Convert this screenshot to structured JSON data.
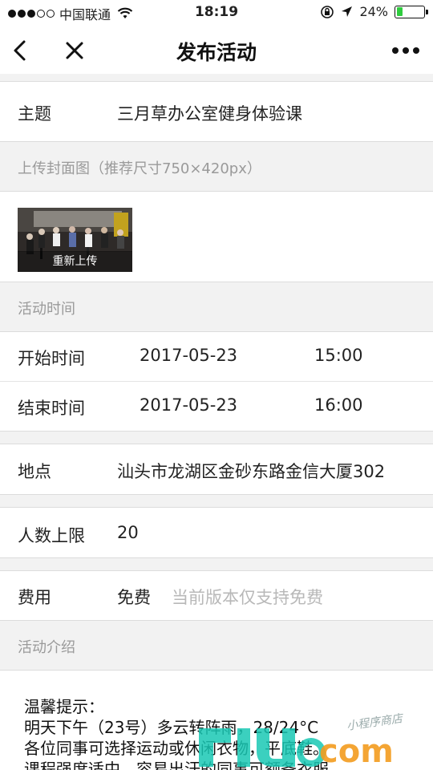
{
  "status_bar": {
    "carrier": "中国联通",
    "time": "18:19",
    "battery": "24%",
    "battery_level": 0.24,
    "signal_bars": 3
  },
  "nav": {
    "title": "发布活动"
  },
  "form": {
    "topic": {
      "label": "主题",
      "value": "三月草办公室健身体验课"
    },
    "cover_section_label": "上传封面图（推荐尺寸750×420px）",
    "reupload_label": "重新上传",
    "time_section_label": "活动时间",
    "start": {
      "label": "开始时间",
      "date": "2017-05-23",
      "time": "15:00"
    },
    "end": {
      "label": "结束时间",
      "date": "2017-05-23",
      "time": "16:00"
    },
    "location": {
      "label": "地点",
      "value": "汕头市龙湖区金砂东路金信大厦302"
    },
    "limit": {
      "label": "人数上限",
      "value": "20"
    },
    "fee": {
      "label": "费用",
      "value": "免费",
      "hint": "当前版本仅支持免费"
    },
    "intro_section_label": "活动介绍",
    "intro_lines": [
      "温馨提示：",
      "明天下午（23号）多云转阵雨，28/24°C",
      "各位同事可选择运动或休闲衣物，平底鞋。",
      "课程强度适中，容易出汗的同事可额备衣服"
    ]
  },
  "watermark": {
    "text": "com",
    "small_text": "小程序商店"
  },
  "colors": {
    "battery_green": "#2fcc3e",
    "watermark_teal": "#19c8b4",
    "watermark_orange": "#f39c1f",
    "hint_gray": "#b8b8b8"
  }
}
